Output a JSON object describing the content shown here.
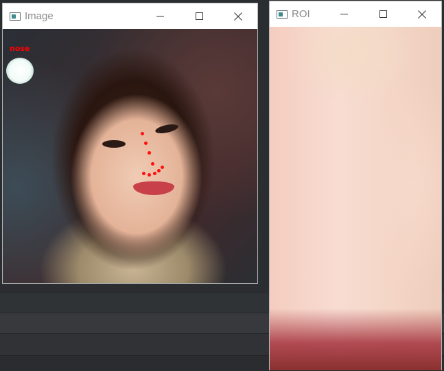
{
  "image_window": {
    "title": "Image",
    "overlay_label": "nose",
    "landmark_color": "#ff0000"
  },
  "roi_window": {
    "title": "ROI"
  },
  "window_controls": {
    "minimize_icon": "minimize-icon",
    "maximize_icon": "maximize-icon",
    "close_icon": "close-icon"
  }
}
